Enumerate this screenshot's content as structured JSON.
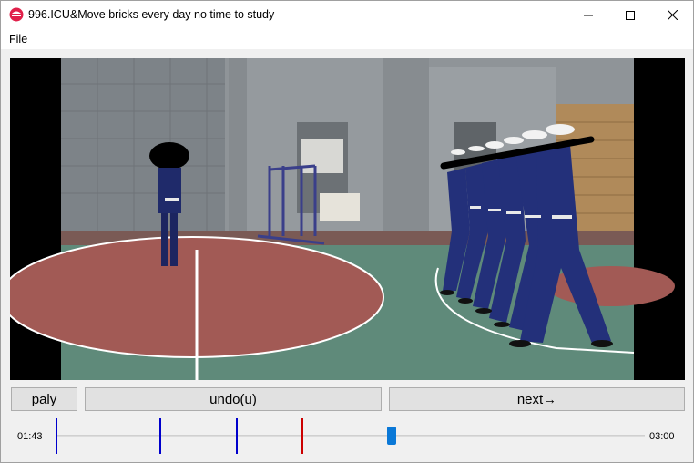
{
  "window": {
    "title": "996.ICU&Move bricks every day no time to study",
    "controls": [
      "minimize",
      "maximize",
      "close"
    ]
  },
  "menu": {
    "items": [
      "File"
    ]
  },
  "video": {
    "content": "Uniformed personnel marching in formation on a sports court"
  },
  "buttons": {
    "play_label": "paly",
    "undo_label": "undo(u)",
    "next_label": "next→"
  },
  "timeline": {
    "current_time": "01:43",
    "total_time": "03:00",
    "position_fraction": 0.57,
    "markers": [
      {
        "position_fraction": 0.0,
        "color": "#0000cc"
      },
      {
        "position_fraction": 0.176,
        "color": "#0000cc"
      },
      {
        "position_fraction": 0.306,
        "color": "#0000cc"
      },
      {
        "position_fraction": 0.418,
        "color": "#cc0000"
      }
    ]
  },
  "colors": {
    "accent": "#0a78d7",
    "marker_blue": "#0000cc",
    "marker_red": "#cc0000"
  }
}
